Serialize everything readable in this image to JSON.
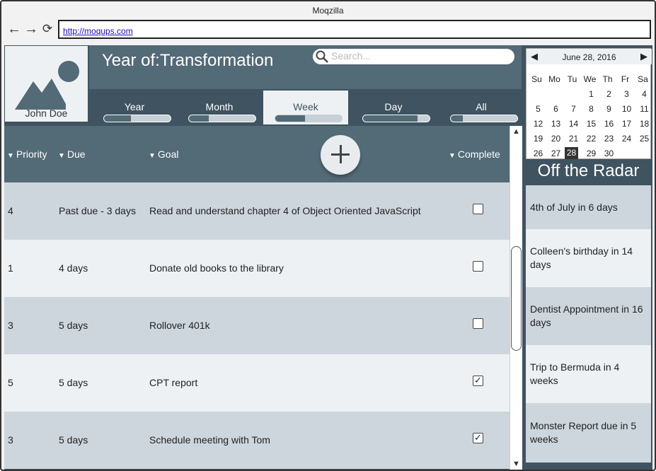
{
  "browser": {
    "title": "Moqzilla",
    "url": "http://moqups.com",
    "back_icon": "←",
    "forward_icon": "→",
    "reload_icon": "⟳"
  },
  "profile": {
    "name": "John Doe"
  },
  "header": {
    "title": "Year of:Transformation",
    "search_placeholder": "Search..."
  },
  "tabs": [
    {
      "label": "Year",
      "progress": 0.4
    },
    {
      "label": "Month",
      "progress": 0.3
    },
    {
      "label": "Week",
      "progress": 0.45
    },
    {
      "label": "Day",
      "progress": 0.82
    },
    {
      "label": "All",
      "progress": 0.18
    }
  ],
  "active_tab": "Week",
  "table": {
    "columns": {
      "priority": "Priority",
      "due": "Due",
      "goal": "Goal",
      "complete": "Complete"
    },
    "sort_arrow": "▼",
    "add_label": "+",
    "rows": [
      {
        "priority": "4",
        "due": "Past due - 3 days",
        "goal": "Read and understand chapter 4 of Object Oriented JavaScript",
        "complete": false
      },
      {
        "priority": "1",
        "due": "4 days",
        "goal": "Donate old books to the library",
        "complete": false
      },
      {
        "priority": "3",
        "due": "5 days",
        "goal": "Rollover 401k",
        "complete": false
      },
      {
        "priority": "5",
        "due": "5 days",
        "goal": "CPT report",
        "complete": true
      },
      {
        "priority": "3",
        "due": "5 days",
        "goal": "Schedule meeting with Tom",
        "complete": true
      }
    ],
    "check_mark": "✓",
    "scroll_up": "▲",
    "scroll_down": "▼"
  },
  "calendar": {
    "title": "June 28, 2016",
    "prev": "◀",
    "next": "▶",
    "weekdays": [
      "Su",
      "Mo",
      "Tu",
      "We",
      "Th",
      "Fr",
      "Sa"
    ],
    "weeks": [
      [
        "",
        "",
        "",
        "1",
        "2",
        "3",
        "4"
      ],
      [
        "5",
        "6",
        "7",
        "8",
        "9",
        "10",
        "11"
      ],
      [
        "12",
        "13",
        "14",
        "15",
        "16",
        "17",
        "18"
      ],
      [
        "19",
        "20",
        "21",
        "22",
        "23",
        "24",
        "25"
      ],
      [
        "26",
        "27",
        "28",
        "29",
        "30",
        "",
        ""
      ]
    ],
    "selected": "28"
  },
  "radar": {
    "title": "Off the Radar",
    "items": [
      "4th of July in 6 days",
      "Colleen's birthday in 14 days",
      "Dentist Appointment in 16 days",
      "Trip to Bermuda in 4 weeks",
      "Monster Report due in 5 weeks"
    ]
  },
  "colors": {
    "primary": "#536a77",
    "dark": "#3f5360",
    "light_row": "#eef1f3",
    "alt_row": "#cdd6dc"
  }
}
